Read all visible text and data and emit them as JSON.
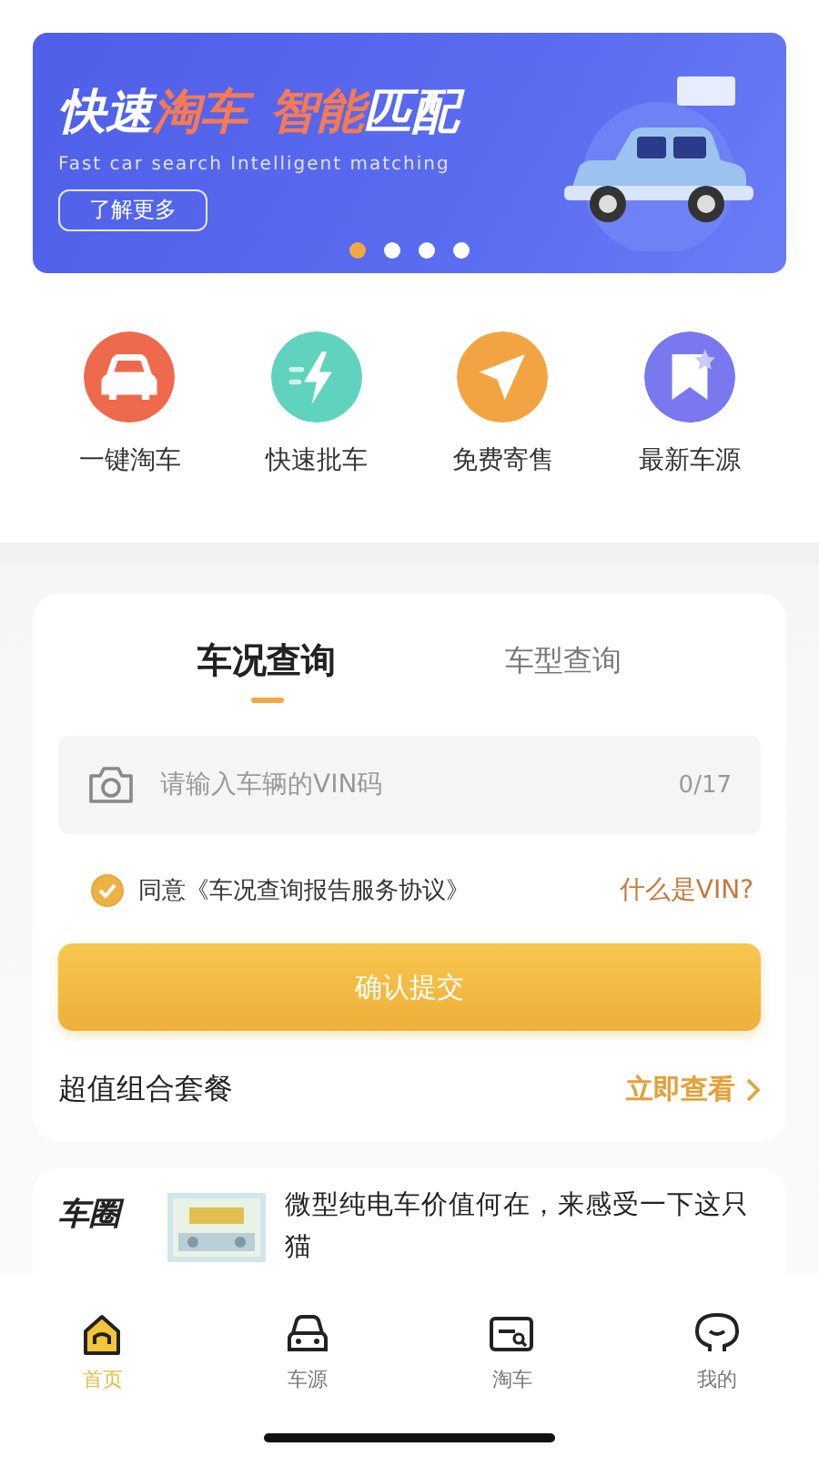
{
  "banner": {
    "title_parts": [
      {
        "text": "快速",
        "accent": false
      },
      {
        "text": "淘车",
        "accent": true
      },
      {
        "text": "智能",
        "accent": true
      },
      {
        "text": "匹配",
        "accent": false
      }
    ],
    "subtitle": "Fast car search Intelligent matching",
    "button": "了解更多",
    "dots": [
      {
        "selected": true
      },
      {
        "selected": false
      },
      {
        "selected": false
      },
      {
        "selected": false
      }
    ]
  },
  "shortcuts": [
    {
      "label": "一键淘车",
      "kind": "car",
      "color": "#ef6a4c"
    },
    {
      "label": "快速批车",
      "kind": "bolt",
      "color": "#5fd3bd"
    },
    {
      "label": "免费寄售",
      "kind": "plane",
      "color": "#f3a442"
    },
    {
      "label": "最新车源",
      "kind": "bookmark",
      "color": "#7a78ee"
    }
  ],
  "query_card": {
    "tabs": [
      {
        "label": "车况查询",
        "selected": true
      },
      {
        "label": "车型查询",
        "selected": false
      }
    ],
    "vin_field": {
      "placeholder": "请输入车辆的VIN码",
      "counter": "0/17"
    },
    "agreement": {
      "checked": true,
      "text": "同意《车况查询报告服务协议》",
      "help_link": "什么是VIN?"
    },
    "submit": "确认提交",
    "package": {
      "title": "超值组合套餐",
      "link": "立即查看"
    }
  },
  "news": {
    "brand": "车圈",
    "title": "微型纯电车价值何在，来感受一下这只猫"
  },
  "tab_bar": [
    {
      "label": "首页",
      "kind": "home",
      "selected": true
    },
    {
      "label": "车源",
      "kind": "car",
      "selected": false
    },
    {
      "label": "淘车",
      "kind": "search",
      "selected": false
    },
    {
      "label": "我的",
      "kind": "profile",
      "selected": false
    }
  ]
}
